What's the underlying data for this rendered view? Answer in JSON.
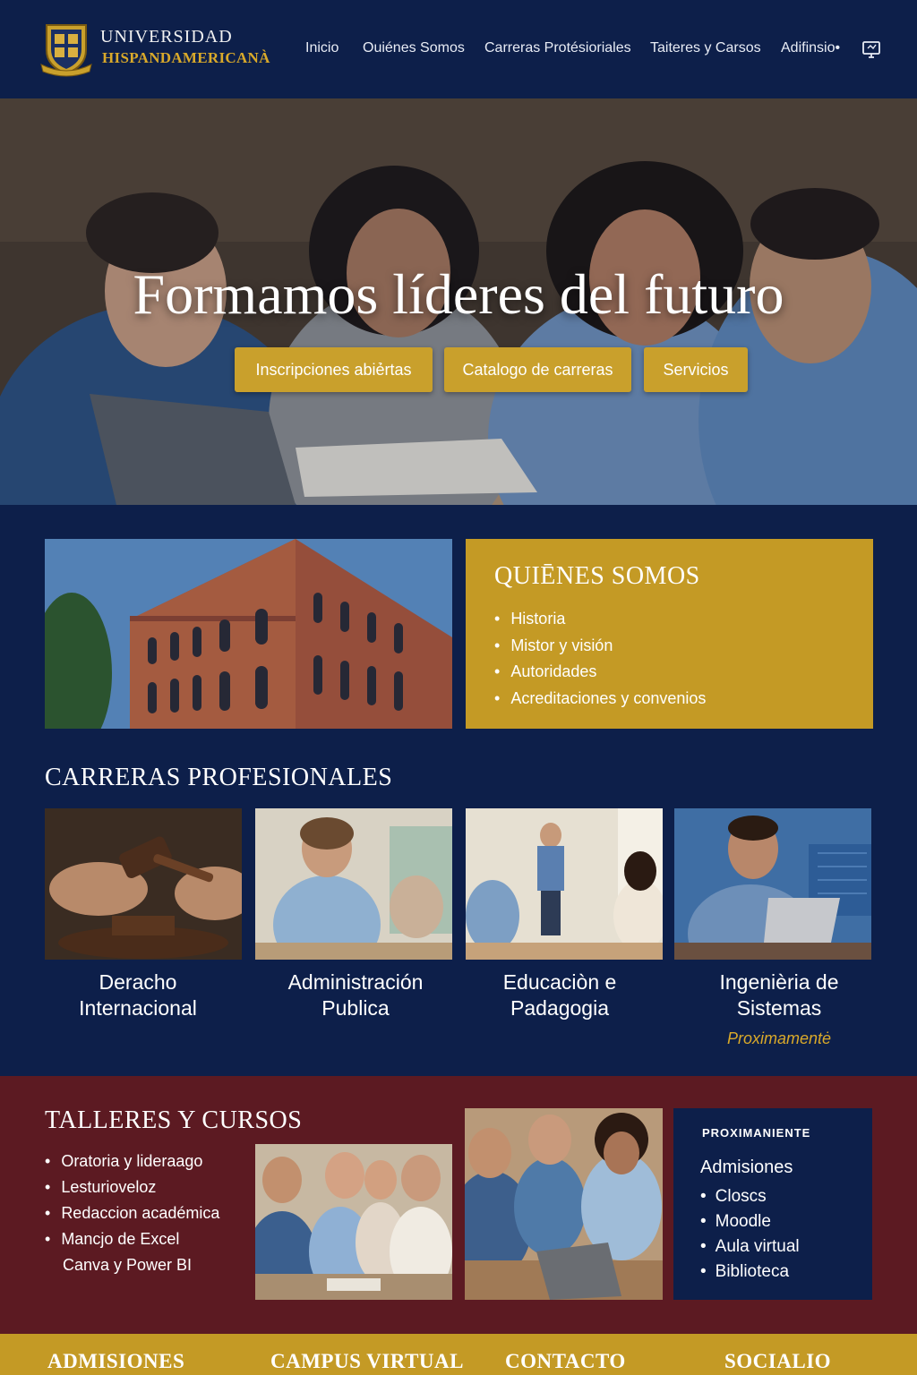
{
  "header": {
    "brand_line1": "UNIVERSIDAD",
    "brand_line2": "HISPANDAMERICANÀ",
    "nav": [
      "Inicio",
      "Ouiénes Somos",
      "Carreras Protésioriales",
      "Taiteres y Carsos",
      "Adifinsio•"
    ]
  },
  "hero": {
    "title": "Formamos líderes del futuro",
    "buttons": [
      "Inscripciones abiẻrtas",
      "Catalogo de carreras",
      "Servicios"
    ]
  },
  "about": {
    "title": "QUIĒNES SOMOS",
    "items": [
      "Historia",
      "Mistor y visión",
      "Autoridades",
      "Acreditaciones y convenios"
    ]
  },
  "careers": {
    "title": "CARRERAS PROFESIONALES",
    "items": [
      {
        "line1": "Deracho",
        "line2": "Internacional"
      },
      {
        "line1": "Administración",
        "line2": "Publica"
      },
      {
        "line1": "Educaciòn e",
        "line2": "Padagogia"
      },
      {
        "line1": "Ingenièria de",
        "line2": "Sistemas"
      }
    ],
    "soon_label": "Proximamentė"
  },
  "workshops": {
    "title": "TALLERES Y CURSOS",
    "items": [
      "Oratoria y lideraago",
      "Lesturioveloz",
      "Redaccion académica",
      "Mancjo de Excel"
    ],
    "continuation": "Canva y Power BI"
  },
  "panel": {
    "tag": "PROXIMANIENTE",
    "heading": "Admisiones",
    "items": [
      "Closcs",
      "Moodle",
      "Aula virtual",
      "Biblioteca"
    ]
  },
  "footer": {
    "items": [
      "ADMISIONES",
      "CAMPUS VIRTUAL",
      "CONTACTO",
      "SOCIALIO"
    ]
  },
  "colors": {
    "navy": "#0d1f4a",
    "gold": "#c49a25",
    "maroon": "#5c1a22"
  }
}
